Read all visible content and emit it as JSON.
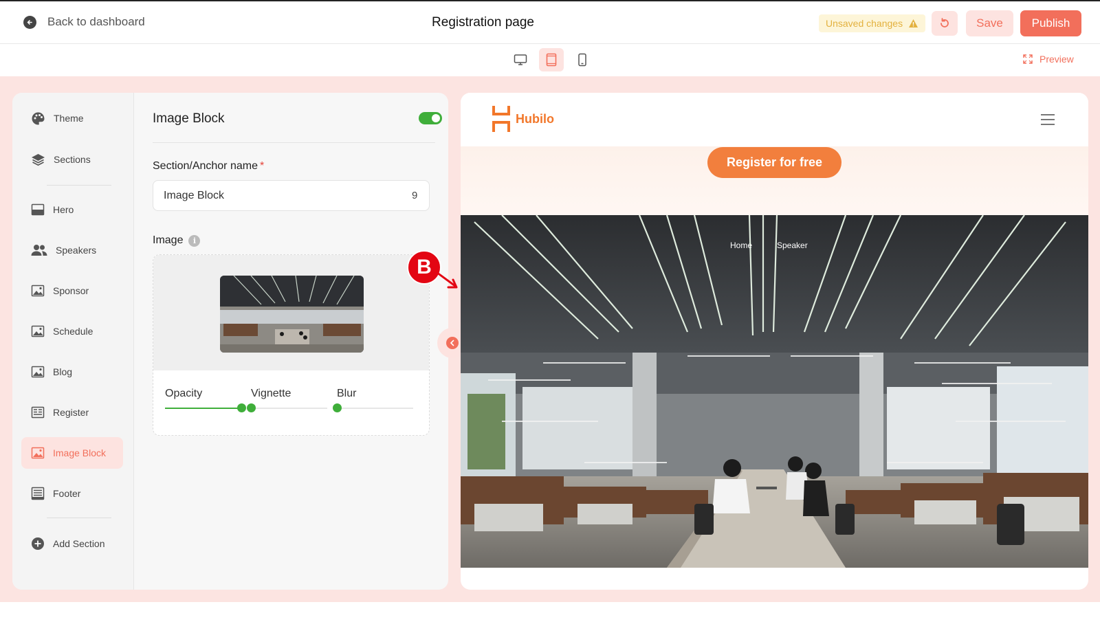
{
  "header": {
    "back_label": "Back to dashboard",
    "page_title": "Registration page",
    "unsaved_label": "Unsaved changes",
    "save_label": "Save",
    "publish_label": "Publish"
  },
  "device_bar": {
    "devices": [
      "desktop",
      "tablet",
      "mobile"
    ],
    "active_device": "tablet",
    "preview_label": "Preview"
  },
  "sidebar": {
    "items": [
      {
        "label": "Theme",
        "icon": "palette-icon"
      },
      {
        "label": "Sections",
        "icon": "layers-icon"
      },
      {
        "label": "Hero",
        "icon": "hero-icon"
      },
      {
        "label": "Speakers",
        "icon": "users-icon"
      },
      {
        "label": "Sponsor",
        "icon": "image-icon"
      },
      {
        "label": "Schedule",
        "icon": "image-icon"
      },
      {
        "label": "Blog",
        "icon": "image-icon"
      },
      {
        "label": "Register",
        "icon": "form-icon"
      },
      {
        "label": "Image Block",
        "icon": "image-icon",
        "active": true
      },
      {
        "label": "Footer",
        "icon": "footer-icon"
      },
      {
        "label": "Add Section",
        "icon": "plus-circle-icon"
      }
    ]
  },
  "panel": {
    "title": "Image Block",
    "enabled": true,
    "anchor_label": "Section/Anchor name",
    "anchor_required_mark": "*",
    "anchor_value": "Image Block",
    "anchor_counter": "9",
    "image_label": "Image",
    "info_glyph": "i",
    "sliders": [
      {
        "label": "Opacity",
        "value": 1.0
      },
      {
        "label": "Vignette",
        "value": 0.0
      },
      {
        "label": "Blur",
        "value": 0.0
      }
    ]
  },
  "annotation": {
    "marker": "B"
  },
  "canvas": {
    "logo_text": "Hubilo",
    "cta_label": "Register for free",
    "overlay_nav": [
      "Home",
      "Speaker"
    ]
  },
  "colors": {
    "accent": "#f26f5b",
    "accent_soft": "#fde3e0",
    "workspace_bg": "#fce4e1",
    "success": "#3fae3a",
    "warning": "#e3b13e",
    "cta": "#f27f3d",
    "marker": "#e30613"
  }
}
